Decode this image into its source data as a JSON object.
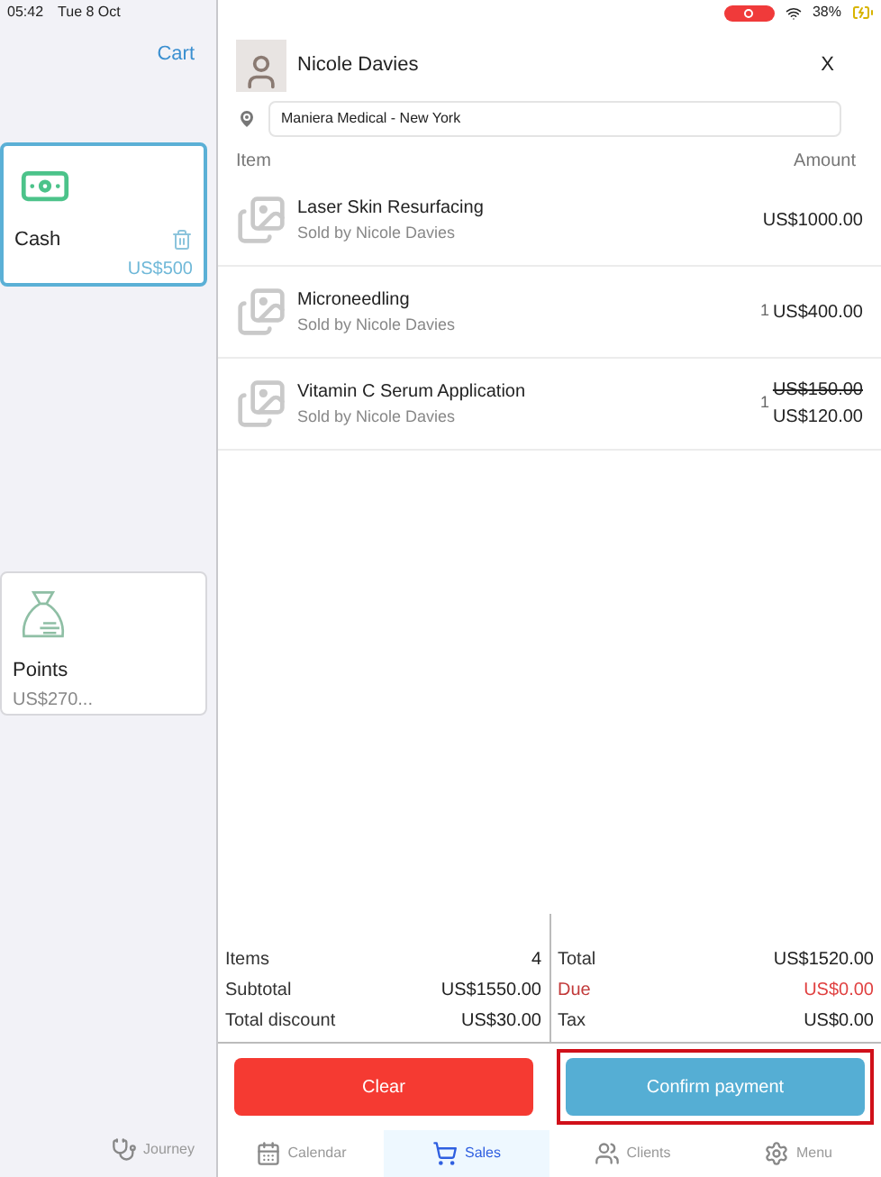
{
  "status_bar": {
    "time": "05:42",
    "date": "Tue 8 Oct",
    "battery": "38%"
  },
  "left_panel": {
    "title": "Cart",
    "payment_methods": [
      {
        "kind": "cash",
        "label": "Cash",
        "amount": "US$500",
        "selected": true
      },
      {
        "kind": "points",
        "label": "Points",
        "amount": "US$270...",
        "selected": false
      }
    ],
    "tabs": [
      {
        "label": "Journey",
        "selected": false
      }
    ]
  },
  "client": {
    "name": "Nicole Davies",
    "close": "X",
    "location": "Maniera Medical - New York"
  },
  "table": {
    "columns": [
      "Item",
      "Amount"
    ],
    "rows": [
      {
        "name": "Laser Skin Resurfacing",
        "sold_by": "Sold by Nicole Davies",
        "price": "US$1000.00"
      },
      {
        "name": "Microneedling",
        "sold_by": "Sold by Nicole Davies",
        "quantity": "1",
        "price": "US$400.00"
      },
      {
        "name": "Vitamin C Serum Application",
        "sold_by": "Sold by Nicole Davies",
        "quantity": "1",
        "original_price": "US$150.00",
        "price": "US$120.00"
      }
    ]
  },
  "summary_left": [
    {
      "label": "Items",
      "value": "4",
      "kind": "normal"
    },
    {
      "label": "Subtotal",
      "value": "US$1550.00",
      "kind": "normal"
    },
    {
      "label": "Total discount",
      "value": "US$30.00",
      "kind": "normal"
    }
  ],
  "summary_right": [
    {
      "label": "Total",
      "value": "US$1520.00",
      "kind": "normal"
    },
    {
      "label": "Due",
      "value": "US$0.00",
      "kind": "due"
    },
    {
      "label": "Tax",
      "value": "US$0.00",
      "kind": "normal"
    }
  ],
  "buttons": [
    {
      "kind": "clear",
      "label": "Clear",
      "highlighted": false
    },
    {
      "kind": "confirm",
      "label": "Confirm payment",
      "highlighted": true
    }
  ],
  "tab_bar": [
    {
      "kind": "calendar",
      "label": "Calendar",
      "selected": false
    },
    {
      "kind": "sales",
      "label": "Sales",
      "selected": true
    },
    {
      "kind": "clients",
      "label": "Clients",
      "selected": false
    },
    {
      "kind": "menu",
      "label": "Menu",
      "selected": false
    }
  ]
}
